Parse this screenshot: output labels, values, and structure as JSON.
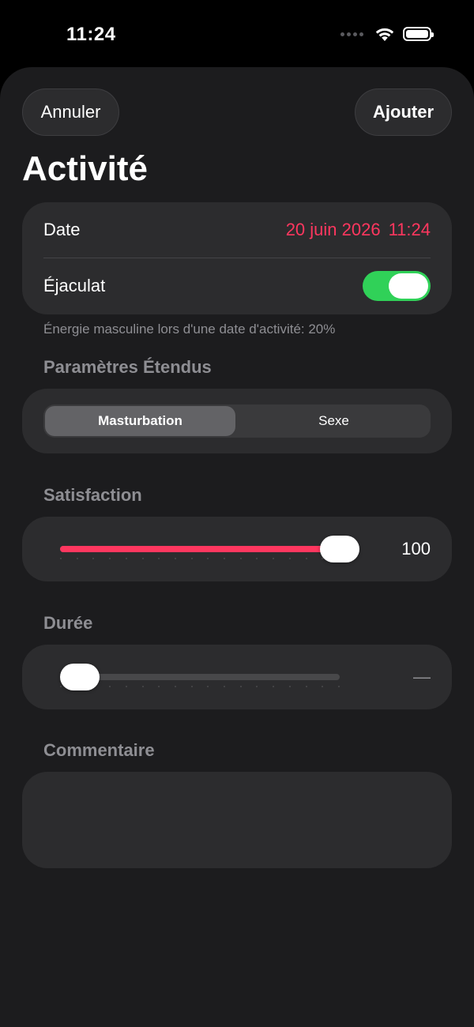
{
  "status": {
    "time": "11:24"
  },
  "header": {
    "cancel_label": "Annuler",
    "add_label": "Ajouter",
    "title": "Activité"
  },
  "date_row": {
    "label": "Date",
    "date": "20 juin 2026",
    "time": "11:24"
  },
  "ejaculation": {
    "label": "Éjaculat",
    "on": true,
    "accent": "#30d158"
  },
  "footnote": "Énergie masculine lors d'une date d'activité: 20%",
  "extended": {
    "title": "Paramètres Étendus",
    "options": [
      "Masturbation",
      "Sexe"
    ],
    "selected": "Masturbation"
  },
  "satisfaction": {
    "title": "Satisfaction",
    "value": 100,
    "value_label": "100",
    "accent": "#ff375f"
  },
  "duration": {
    "title": "Durée",
    "value": 0,
    "value_label": "—"
  },
  "comment": {
    "title": "Commentaire",
    "value": ""
  }
}
